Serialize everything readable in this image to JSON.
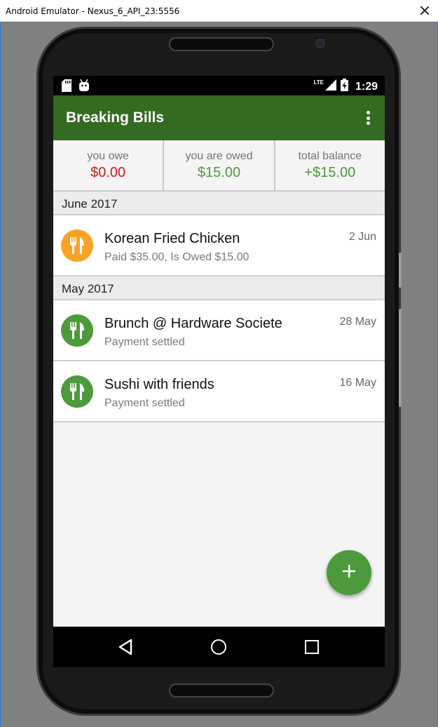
{
  "window": {
    "title": "Android Emulator - Nexus_6_API_23:5556"
  },
  "statusbar": {
    "time": "1:29",
    "network": "LTE"
  },
  "appbar": {
    "title": "Breaking Bills"
  },
  "summary": {
    "owe_label": "you owe",
    "owe_value": "$0.00",
    "owed_label": "you are owed",
    "owed_value": "$15.00",
    "total_label": "total balance",
    "total_value": "+$15.00"
  },
  "colors": {
    "appbar": "#336b21",
    "accent_green": "#4d9a3c",
    "negative_red": "#d11b1b",
    "pending_orange": "#f8a326"
  },
  "sections": [
    {
      "header": "June 2017",
      "items": [
        {
          "title": "Korean Fried Chicken",
          "subtitle": "Paid $35.00, Is Owed $15.00",
          "date": "2 Jun",
          "icon": "fork-knife-icon"
        }
      ]
    },
    {
      "header": "May 2017",
      "items": [
        {
          "title": "Brunch @ Hardware Societe",
          "subtitle": "Payment settled",
          "date": "28 May",
          "icon": "fork-knife-icon"
        },
        {
          "title": "Sushi with friends",
          "subtitle": "Payment settled",
          "date": "16 May",
          "icon": "fork-knife-icon"
        }
      ]
    }
  ],
  "fab": {
    "icon": "plus-icon"
  },
  "navbar": {
    "icons": [
      "back-icon",
      "home-icon",
      "recents-icon"
    ]
  }
}
